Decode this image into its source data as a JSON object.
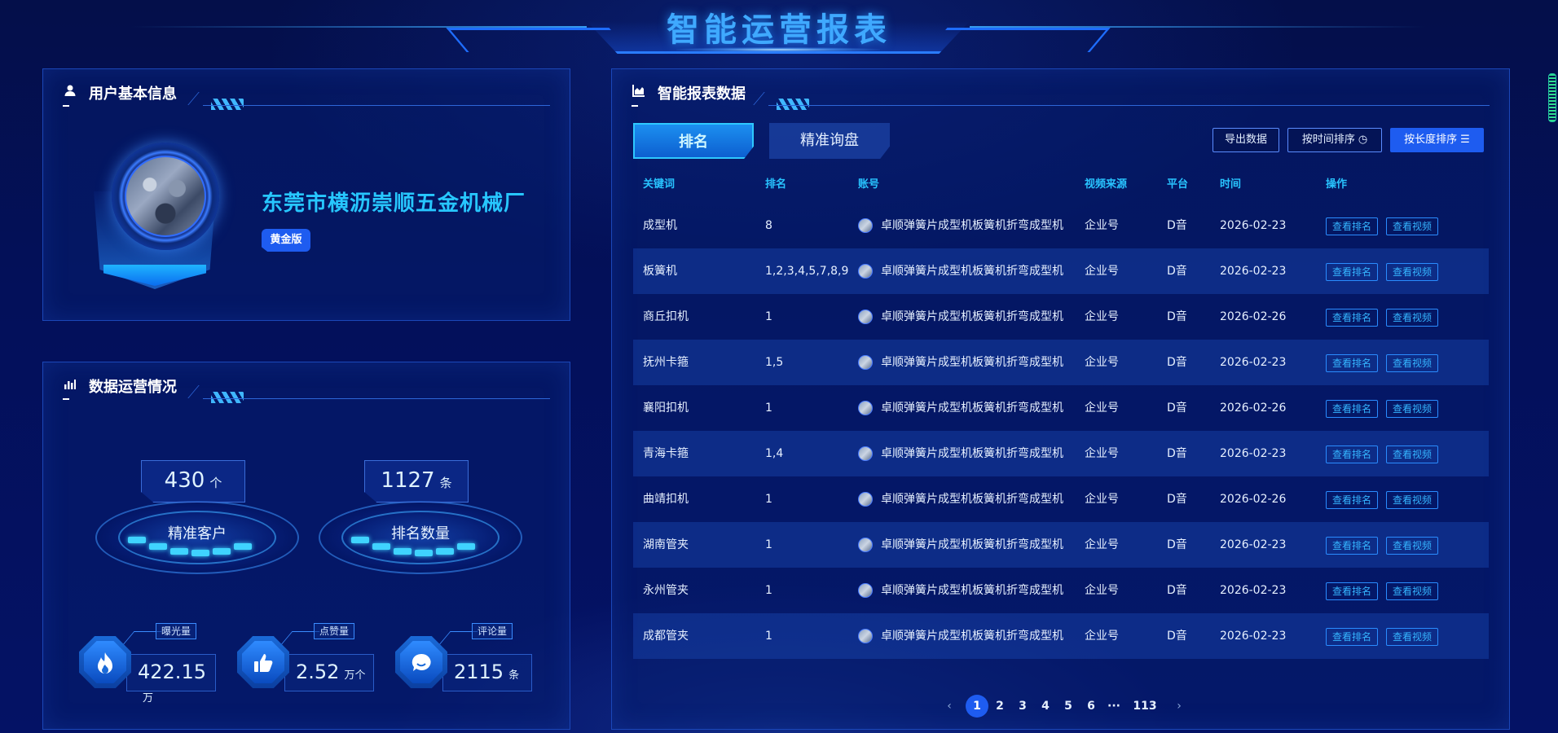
{
  "page": {
    "title": "智能运营报表"
  },
  "user_panel": {
    "title": "用户基本信息",
    "company_name": "东莞市横沥崇顺五金机械厂",
    "tier": "黄金版"
  },
  "ops_panel": {
    "title": "数据运营情况",
    "dials": [
      {
        "value": "430",
        "unit": "个",
        "label": "精准客户"
      },
      {
        "value": "1127",
        "unit": "条",
        "label": "排名数量"
      }
    ],
    "metrics": [
      {
        "tag": "曝光量",
        "value": "422.15",
        "unit": "万",
        "icon": "flame-icon",
        "glyph": "🔥"
      },
      {
        "tag": "点赞量",
        "value": "2.52",
        "unit": "万个",
        "icon": "thumbs-up-icon",
        "glyph": "👍"
      },
      {
        "tag": "评论量",
        "value": "2115",
        "unit": "条",
        "icon": "comment-icon",
        "glyph": "💬"
      }
    ]
  },
  "report_panel": {
    "title": "智能报表数据",
    "tabs": [
      "排名",
      "精准询盘"
    ],
    "buttons": {
      "export": "导出数据",
      "sort_time": "按时间排序",
      "sort_length": "按长度排序"
    },
    "columns": [
      "关键词",
      "排名",
      "账号",
      "视频来源",
      "平台",
      "时间",
      "操作"
    ],
    "rows": [
      {
        "keyword": "成型机",
        "rank": "8",
        "account": "卓顺弹簧片成型机板簧机折弯成型机",
        "source": "企业号",
        "platform": "D音",
        "time": "2026-02-23"
      },
      {
        "keyword": "板簧机",
        "rank": "1,2,3,4,5,7,8,9",
        "account": "卓顺弹簧片成型机板簧机折弯成型机",
        "source": "企业号",
        "platform": "D音",
        "time": "2026-02-23"
      },
      {
        "keyword": "商丘扣机",
        "rank": "1",
        "account": "卓顺弹簧片成型机板簧机折弯成型机",
        "source": "企业号",
        "platform": "D音",
        "time": "2026-02-26"
      },
      {
        "keyword": "抚州卡箍",
        "rank": "1,5",
        "account": "卓顺弹簧片成型机板簧机折弯成型机",
        "source": "企业号",
        "platform": "D音",
        "time": "2026-02-23"
      },
      {
        "keyword": "襄阳扣机",
        "rank": "1",
        "account": "卓顺弹簧片成型机板簧机折弯成型机",
        "source": "企业号",
        "platform": "D音",
        "time": "2026-02-26"
      },
      {
        "keyword": "青海卡箍",
        "rank": "1,4",
        "account": "卓顺弹簧片成型机板簧机折弯成型机",
        "source": "企业号",
        "platform": "D音",
        "time": "2026-02-23"
      },
      {
        "keyword": "曲靖扣机",
        "rank": "1",
        "account": "卓顺弹簧片成型机板簧机折弯成型机",
        "source": "企业号",
        "platform": "D音",
        "time": "2026-02-26"
      },
      {
        "keyword": "湖南管夹",
        "rank": "1",
        "account": "卓顺弹簧片成型机板簧机折弯成型机",
        "source": "企业号",
        "platform": "D音",
        "time": "2026-02-23"
      },
      {
        "keyword": "永州管夹",
        "rank": "1",
        "account": "卓顺弹簧片成型机板簧机折弯成型机",
        "source": "企业号",
        "platform": "D音",
        "time": "2026-02-23"
      },
      {
        "keyword": "成都管夹",
        "rank": "1",
        "account": "卓顺弹簧片成型机板簧机折弯成型机",
        "source": "企业号",
        "platform": "D音",
        "time": "2026-02-23"
      }
    ],
    "row_actions": {
      "view_rank": "查看排名",
      "view_video": "查看视频"
    },
    "pagination": {
      "pages": [
        "1",
        "2",
        "3",
        "4",
        "5",
        "6"
      ],
      "ellipsis": "···",
      "last": "113",
      "current": "1",
      "prev": "‹",
      "next": "›"
    }
  },
  "colors": {
    "accent": "#28c3ff",
    "primary": "#1e5cf0",
    "title": "#3fa9ff"
  }
}
